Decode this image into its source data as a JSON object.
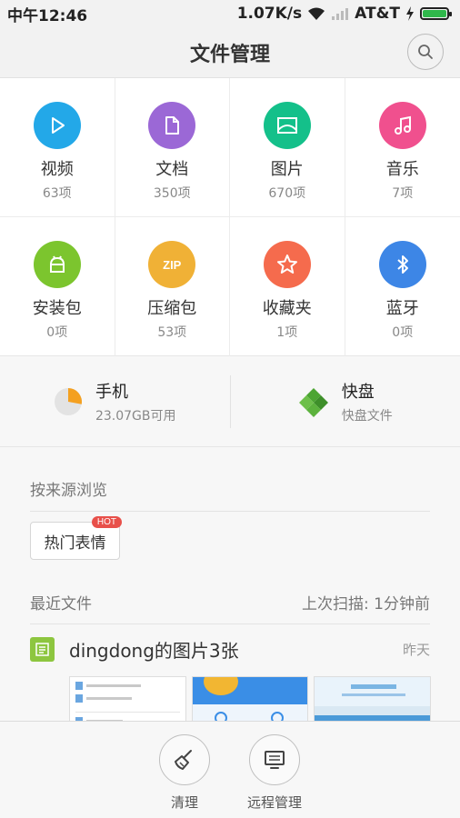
{
  "status_bar": {
    "time": "中午12:46",
    "speed": "1.07K/s",
    "carrier": "AT&T"
  },
  "title_bar": {
    "title": "文件管理",
    "search_icon": "search-icon"
  },
  "categories": [
    {
      "label": "视频",
      "count": "63项",
      "color": "#23a8e8",
      "icon": "play-icon"
    },
    {
      "label": "文档",
      "count": "350项",
      "color": "#9b68d6",
      "icon": "document-icon"
    },
    {
      "label": "图片",
      "count": "670项",
      "color": "#14c08a",
      "icon": "image-icon"
    },
    {
      "label": "音乐",
      "count": "7项",
      "color": "#f0508e",
      "icon": "music-icon"
    },
    {
      "label": "安装包",
      "count": "0项",
      "color": "#7cc52e",
      "icon": "android-icon"
    },
    {
      "label": "压缩包",
      "count": "53项",
      "color": "#f0b136",
      "icon": "zip-icon",
      "badge_text": "ZIP"
    },
    {
      "label": "收藏夹",
      "count": "1项",
      "color": "#f56b4d",
      "icon": "star-icon"
    },
    {
      "label": "蓝牙",
      "count": "0项",
      "color": "#3d86e6",
      "icon": "bluetooth-icon"
    }
  ],
  "storage": [
    {
      "name": "手机",
      "detail": "23.07GB可用",
      "icon": "pie-storage-icon",
      "used_fraction": 0.28,
      "colors": {
        "used": "#f4a020",
        "free": "#e3e3e3"
      }
    },
    {
      "name": "快盘",
      "detail": "快盘文件",
      "icon": "kuaipan-logo-icon",
      "color": "#4ca533"
    }
  ],
  "browse_by_source": {
    "heading": "按来源浏览",
    "button": "热门表情",
    "badge": "HOT"
  },
  "recent": {
    "heading": "最近文件",
    "last_scan": "上次扫描: 1分钟前",
    "items": [
      {
        "name": "dingdong的图片3张",
        "time": "昨天"
      }
    ]
  },
  "bottom_bar": {
    "clean_label": "清理",
    "remote_label": "远程管理"
  }
}
